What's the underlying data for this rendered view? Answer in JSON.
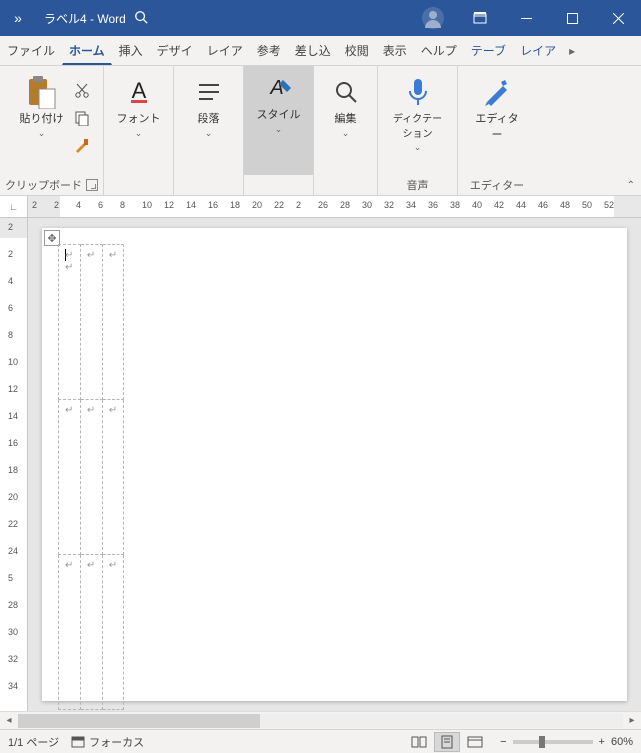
{
  "title": "ラベル4  -  Word",
  "tabs": {
    "file": "ファイル",
    "home": "ホーム",
    "insert": "挿入",
    "design": "デザイ",
    "layout": "レイア",
    "references": "参考",
    "mailings": "差し込",
    "review": "校閲",
    "view": "表示",
    "help": "ヘルプ",
    "table_design": "テーブ",
    "table_layout": "レイア"
  },
  "ribbon": {
    "clipboard": {
      "label": "クリップボード",
      "paste": "貼り付け"
    },
    "font": {
      "label": "フォント"
    },
    "paragraph": {
      "label": "段落"
    },
    "styles": {
      "label": "スタイル"
    },
    "editing": {
      "label": "編集"
    },
    "dictation": {
      "group": "音声",
      "label": "ディクテーション"
    },
    "editor": {
      "group": "エディター",
      "label": "エディター"
    }
  },
  "hruler_numbers": [
    2,
    2,
    4,
    6,
    8,
    10,
    12,
    14,
    16,
    18,
    20,
    22,
    2,
    26,
    28,
    30,
    32,
    34,
    36,
    38,
    40,
    42,
    44,
    46,
    48,
    50,
    52
  ],
  "vruler_numbers": [
    2,
    2,
    4,
    6,
    8,
    10,
    12,
    14,
    16,
    18,
    20,
    22,
    24,
    5,
    28,
    30,
    32,
    34
  ],
  "status": {
    "page": "1/1 ページ",
    "focus": "フォーカス",
    "zoom_minus": "−",
    "zoom_plus": "+",
    "zoom_pct": "60%"
  }
}
